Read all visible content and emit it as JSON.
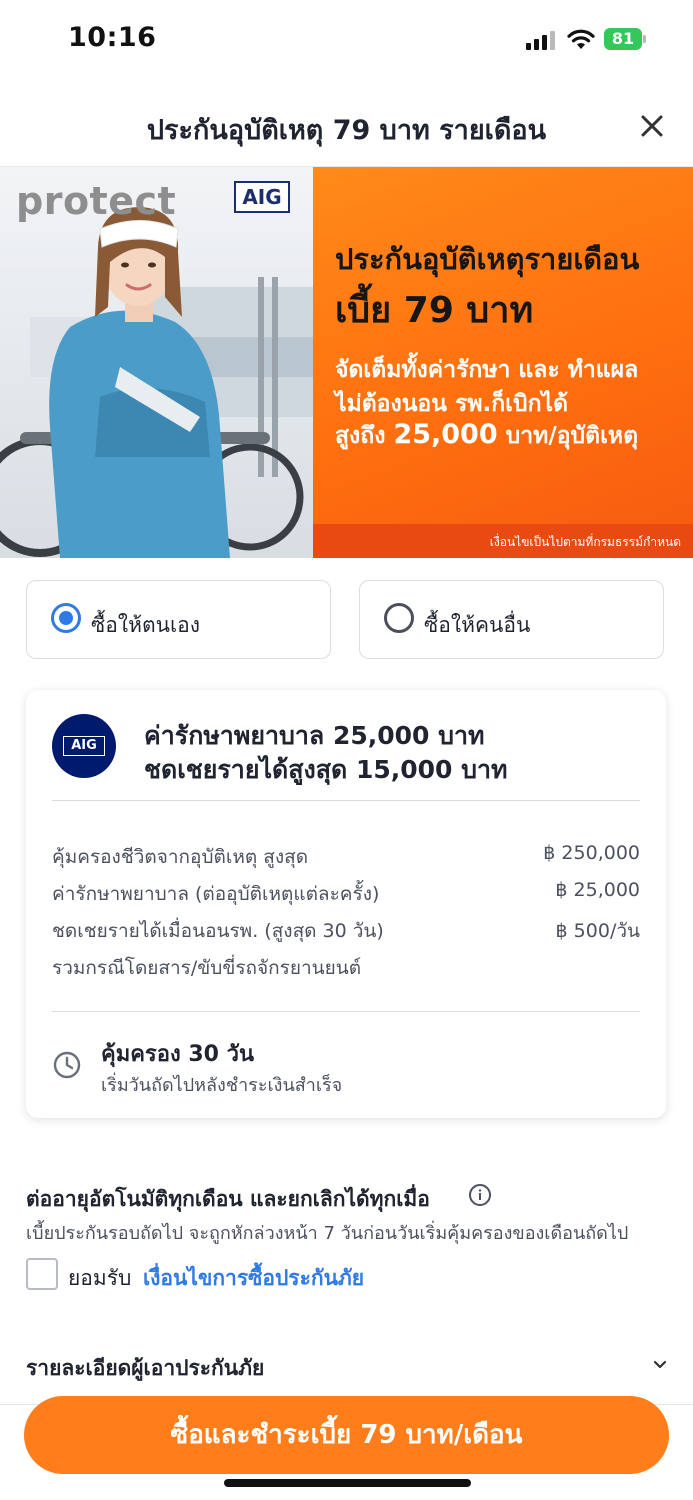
{
  "status_bar": {
    "time": "10:16",
    "battery": "81"
  },
  "header": {
    "title": "ประกันอุบัติเหตุ 79 บาท รายเดือน"
  },
  "banner": {
    "brand": "protect",
    "insurer": "AIG",
    "headline_1": "ประกันอุบัติเหตุรายเดือน",
    "headline_2": "เบี้ย 79 บาท",
    "line_1": "จัดเต็มทั้งค่ารักษา และ ทำแผล",
    "line_2": "ไม่ต้องนอน รพ.ก็เบิกได้",
    "line_3_prefix": "สูงถึง ",
    "line_3_amount": "25,000",
    "line_3_suffix": " บาท/อุบัติเหตุ",
    "note": "เงื่อนไขเป็นไปตามที่กรมธรรม์กำหนด"
  },
  "buyer_options": {
    "self_label": "ซื้อให้ตนเอง",
    "other_label": "ซื้อให้คนอื่น",
    "selected": "self"
  },
  "plan": {
    "insurer_logo": "AIG",
    "title_1": "ค่ารักษาพยาบาล 25,000 บาท",
    "title_2": "ชดเชยรายได้สูงสุด 15,000 บาท",
    "rows": [
      {
        "label": "คุ้มครองชีวิตจากอุบัติเหตุ สูงสุด",
        "value": "฿ 250,000"
      },
      {
        "label": "ค่ารักษาพยาบาล (ต่ออุบัติเหตุแต่ละครั้ง)",
        "value": "฿ 25,000"
      },
      {
        "label": "ชดเชยรายได้เมื่อนอนรพ. (สูงสุด 30 วัน)",
        "value": "฿ 500/วัน"
      },
      {
        "label": "รวมกรณีโดยสาร/ขับขี่รถจักรยานยนต์",
        "value": ""
      }
    ],
    "coverage_title": "คุ้มครอง 30 วัน",
    "coverage_sub": "เริ่มวันถัดไปหลังชำระเงินสำเร็จ"
  },
  "renew": {
    "title": "ต่ออายุอัตโนมัติทุกเดือน และยกเลิกได้ทุกเมื่อ",
    "desc": "เบี้ยประกันรอบถัดไป จะถูกหักล่วงหน้า 7 วันก่อนวันเริ่มคุ้มครองของเดือนถัดไป",
    "accept_label": "ยอมรับ",
    "accept_link": "เงื่อนไขการซื้อประกันภัย",
    "accepted": false
  },
  "insured_details": {
    "title": "รายละเอียดผู้เอาประกันภัย"
  },
  "pay_button": {
    "label": "ซื้อและชำระเบี้ย 79 บาท/เดือน"
  },
  "colors": {
    "accent_orange": "#ff7d1a",
    "link_blue": "#2f7ae5",
    "aig_navy": "#001a6e"
  }
}
